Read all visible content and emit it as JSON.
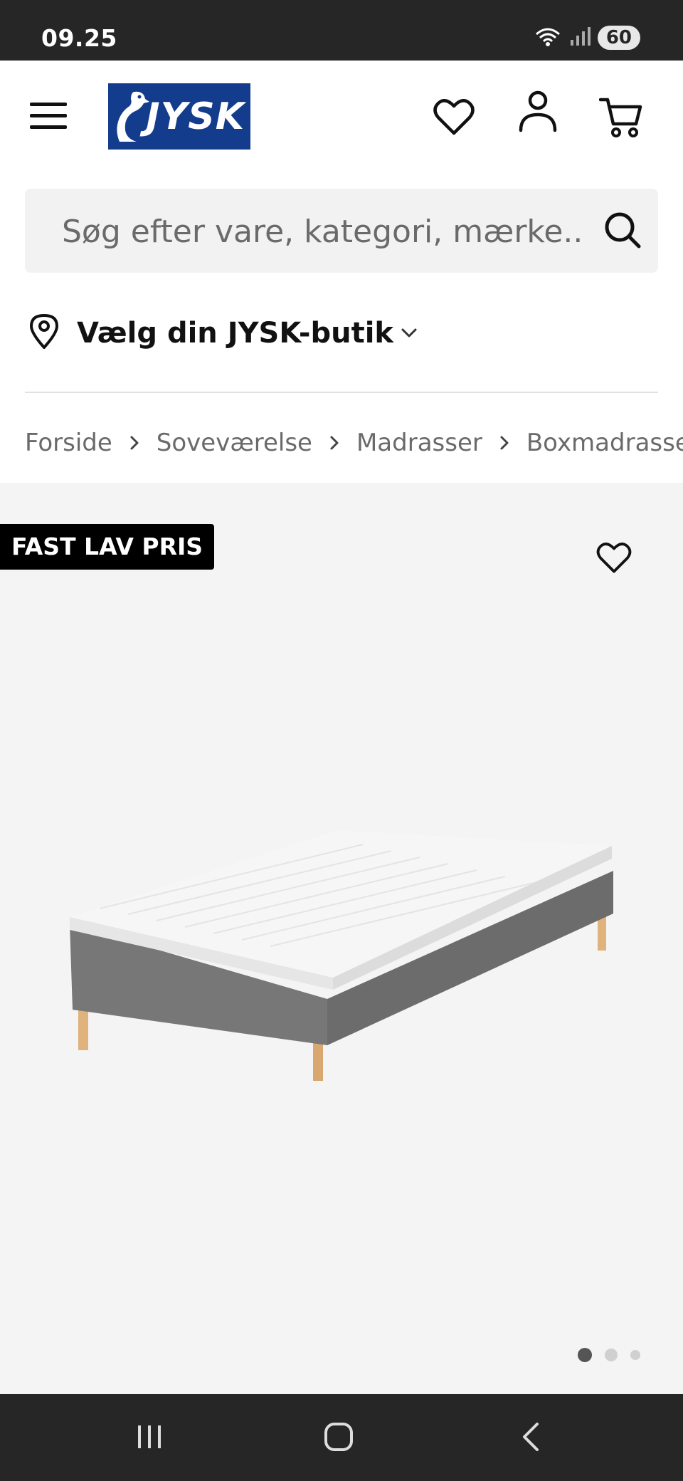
{
  "status_bar": {
    "time": "09.25",
    "battery": "60"
  },
  "header": {
    "logo_text": "JYSK",
    "icons": [
      "menu-icon",
      "heart-icon",
      "user-icon",
      "cart-icon"
    ]
  },
  "search": {
    "placeholder": "Søg efter vare, kategori, mærke.."
  },
  "store": {
    "label": "Vælg din JYSK-butik"
  },
  "breadcrumb": [
    "Forside",
    "Soveværelse",
    "Madrasser",
    "Boxmadrasse"
  ],
  "product": {
    "badge": "FAST LAV PRIS",
    "image_count": 3,
    "active_image": 1
  },
  "colors": {
    "brand": "#143c8c",
    "badge_bg": "#000000",
    "image_bg": "#f4f4f4"
  }
}
